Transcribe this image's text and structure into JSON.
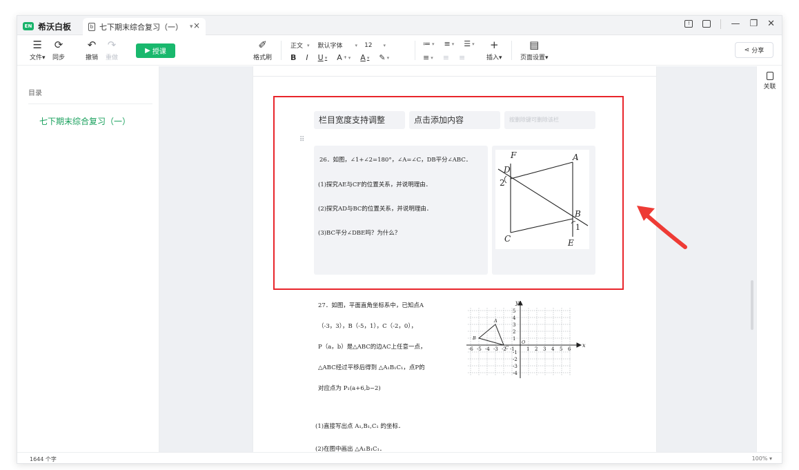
{
  "app": {
    "name": "希沃白板",
    "logo_text": "EN"
  },
  "tab": {
    "title": "七下期末综合复习（一）",
    "caret": "▾",
    "close": "×"
  },
  "toolbar": {
    "file": "文件▾",
    "sync": "同步",
    "undo": "撤销",
    "redo": "重做",
    "teach": "授课",
    "format_brush": "格式刷",
    "style": "正文",
    "font": "默认字体",
    "size": "12",
    "insert": "插入▾",
    "page_setup": "页面设置▾",
    "share": "分享"
  },
  "sidebar": {
    "toc_title": "目录",
    "items": [
      "七下期末综合复习（一）"
    ]
  },
  "right_rail": {
    "related": "关联"
  },
  "columns": {
    "heads": [
      "栏目宽度支持调整",
      "点击添加内容",
      "按删除键可删除该栏"
    ]
  },
  "q26": {
    "stem": "26．如图，∠1+∠2=180°，∠A=∠C，DB平分∠ABC．",
    "p1": "(1)探究AE与CF的位置关系，并说明理由．",
    "p2": "(2)探究AD与BC的位置关系，并说明理由．",
    "p3": "(3)BC平分∠DBE吗？为什么？",
    "labels": {
      "F": "F",
      "A": "A",
      "D": "D",
      "two": "2",
      "B": "B",
      "one": "1",
      "C": "C",
      "E": "E"
    }
  },
  "q27": {
    "l1": "27．如图，平面直角坐标系中，已知点A",
    "l2": "（-3，3），B（-5，1），C（-2，0），",
    "l3": "P（a，b）是△ABC的边AC上任意一点，",
    "l4": "△ABC经过平移后得到 △A₁B₁C₁，点P的",
    "l5": "对应点为 P₁(a+6,b−2)",
    "p1": "(1)直接写出点 A₁,B₁,C₁ 的坐标．",
    "p2": "(2)在图中画出 △A₁B₁C₁．",
    "axis_x": "x",
    "axis_y": "y",
    "origin": "O",
    "xticks": [
      "-6",
      "-5",
      "-4",
      "-3",
      "-2",
      "-1",
      "1",
      "2",
      "3",
      "4",
      "5",
      "6"
    ],
    "yticks": [
      "5",
      "4",
      "3",
      "2",
      "1",
      "-1",
      "-2",
      "-3",
      "-4"
    ],
    "pA": "A",
    "pB": "B",
    "pC": "C"
  },
  "status": {
    "word_count": "1644 个字",
    "zoom": "100% ▾"
  },
  "colors": {
    "accent": "#19b86d",
    "highlight": "#e8242a",
    "arrow": "#ee3b35"
  }
}
